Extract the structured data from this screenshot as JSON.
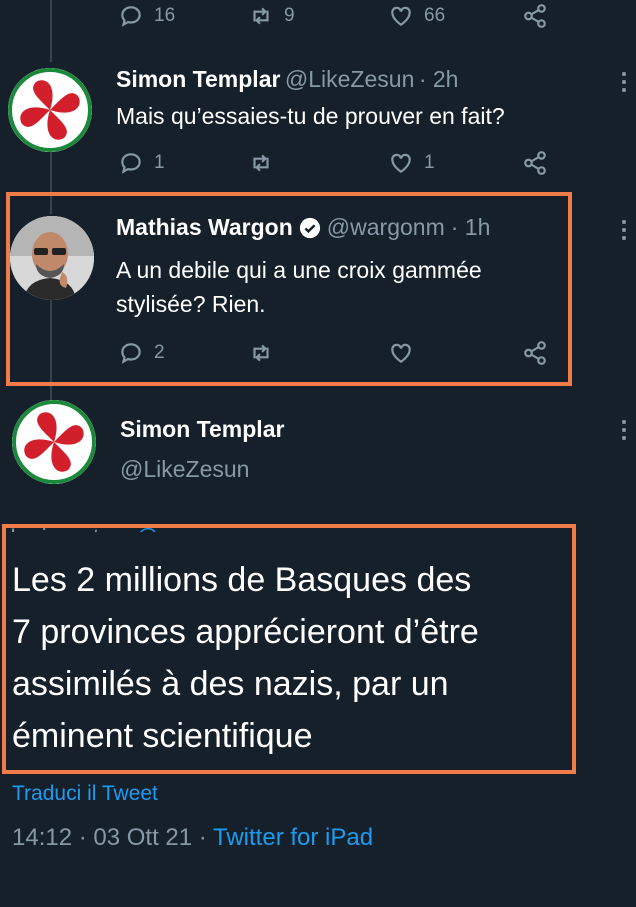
{
  "tweet_top_actions": {
    "reply_count": "16",
    "retweet_count": "9",
    "like_count": "66"
  },
  "tweet1": {
    "name": "Simon Templar",
    "handle": "@LikeZesun",
    "time": "· 2h",
    "text": "Mais qu’essaies-tu de prouver en fait?",
    "reply_count": "1",
    "like_count": "1"
  },
  "tweet2": {
    "name": "Mathias Wargon",
    "handle": "@wargonm",
    "time": "· 1h",
    "text_line1": "A un debile qui a une croix gammée",
    "text_line2": "stylisée? Rien.",
    "reply_count": "2"
  },
  "main_tweet": {
    "name": "Simon Templar",
    "handle": "@LikeZesun",
    "reply_prefix": "In risposta a ",
    "reply_to": "@wargonm",
    "lines": [
      "Les 2 millions de Basques des",
      "7 provinces apprécieront d’être",
      "assimilés à des nazis, par un",
      "éminent scientifique"
    ],
    "translate": "Traduci il Tweet",
    "timestamp": "14:12 · 03 Ott 21 · ",
    "source": "Twitter for iPad"
  },
  "colors": {
    "background": "#15202b",
    "accent": "#1d9bf0",
    "highlight": "#f07c4a",
    "muted": "#8899a6"
  }
}
